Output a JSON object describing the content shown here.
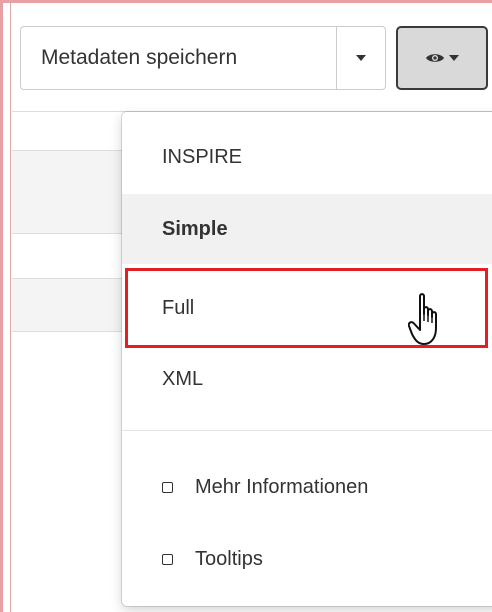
{
  "toolbar": {
    "save_label": "Metadaten speichern",
    "view_button_icon": "eye-icon"
  },
  "dropdown": {
    "items": [
      {
        "label": "INSPIRE",
        "style": "normal"
      },
      {
        "label": "Simple",
        "style": "bold"
      },
      {
        "label": "Full",
        "style": "highlighted"
      },
      {
        "label": "XML",
        "style": "normal"
      }
    ],
    "checkboxes": [
      {
        "label": "Mehr Informationen",
        "checked": false
      },
      {
        "label": "Tooltips",
        "checked": false
      }
    ]
  },
  "colors": {
    "highlight": "#e31e24",
    "frame": "#e8a0a4",
    "active_button_bg": "#d9d9d9"
  }
}
